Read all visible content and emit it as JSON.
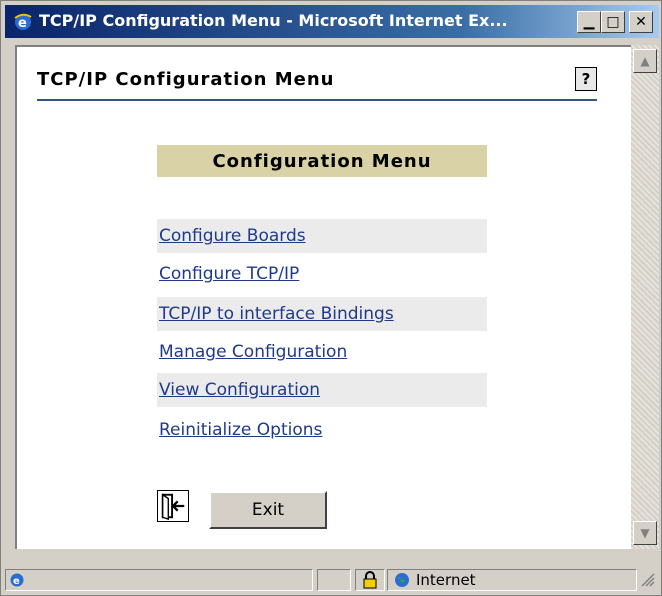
{
  "window": {
    "title": "TCP/IP Configuration Menu - Microsoft Internet Ex...",
    "minimize_glyph": "▁",
    "maximize_glyph": "□",
    "close_glyph": "✕"
  },
  "page": {
    "title": "TCP/IP Configuration Menu",
    "help_glyph": "?"
  },
  "menu": {
    "header": "Configuration Menu",
    "items": [
      {
        "label": "Configure Boards"
      },
      {
        "label": "Configure TCP/IP"
      },
      {
        "label": "TCP/IP to interface Bindings"
      },
      {
        "label": "Manage Configuration"
      },
      {
        "label": "View Configuration"
      },
      {
        "label": "Reinitialize Options"
      }
    ]
  },
  "exit": {
    "label": "Exit"
  },
  "status": {
    "zone": "Internet"
  },
  "colors": {
    "menu_header_bg": "#d8d2a6",
    "link": "#1f3a8a",
    "title_bar": "#0a246a"
  }
}
